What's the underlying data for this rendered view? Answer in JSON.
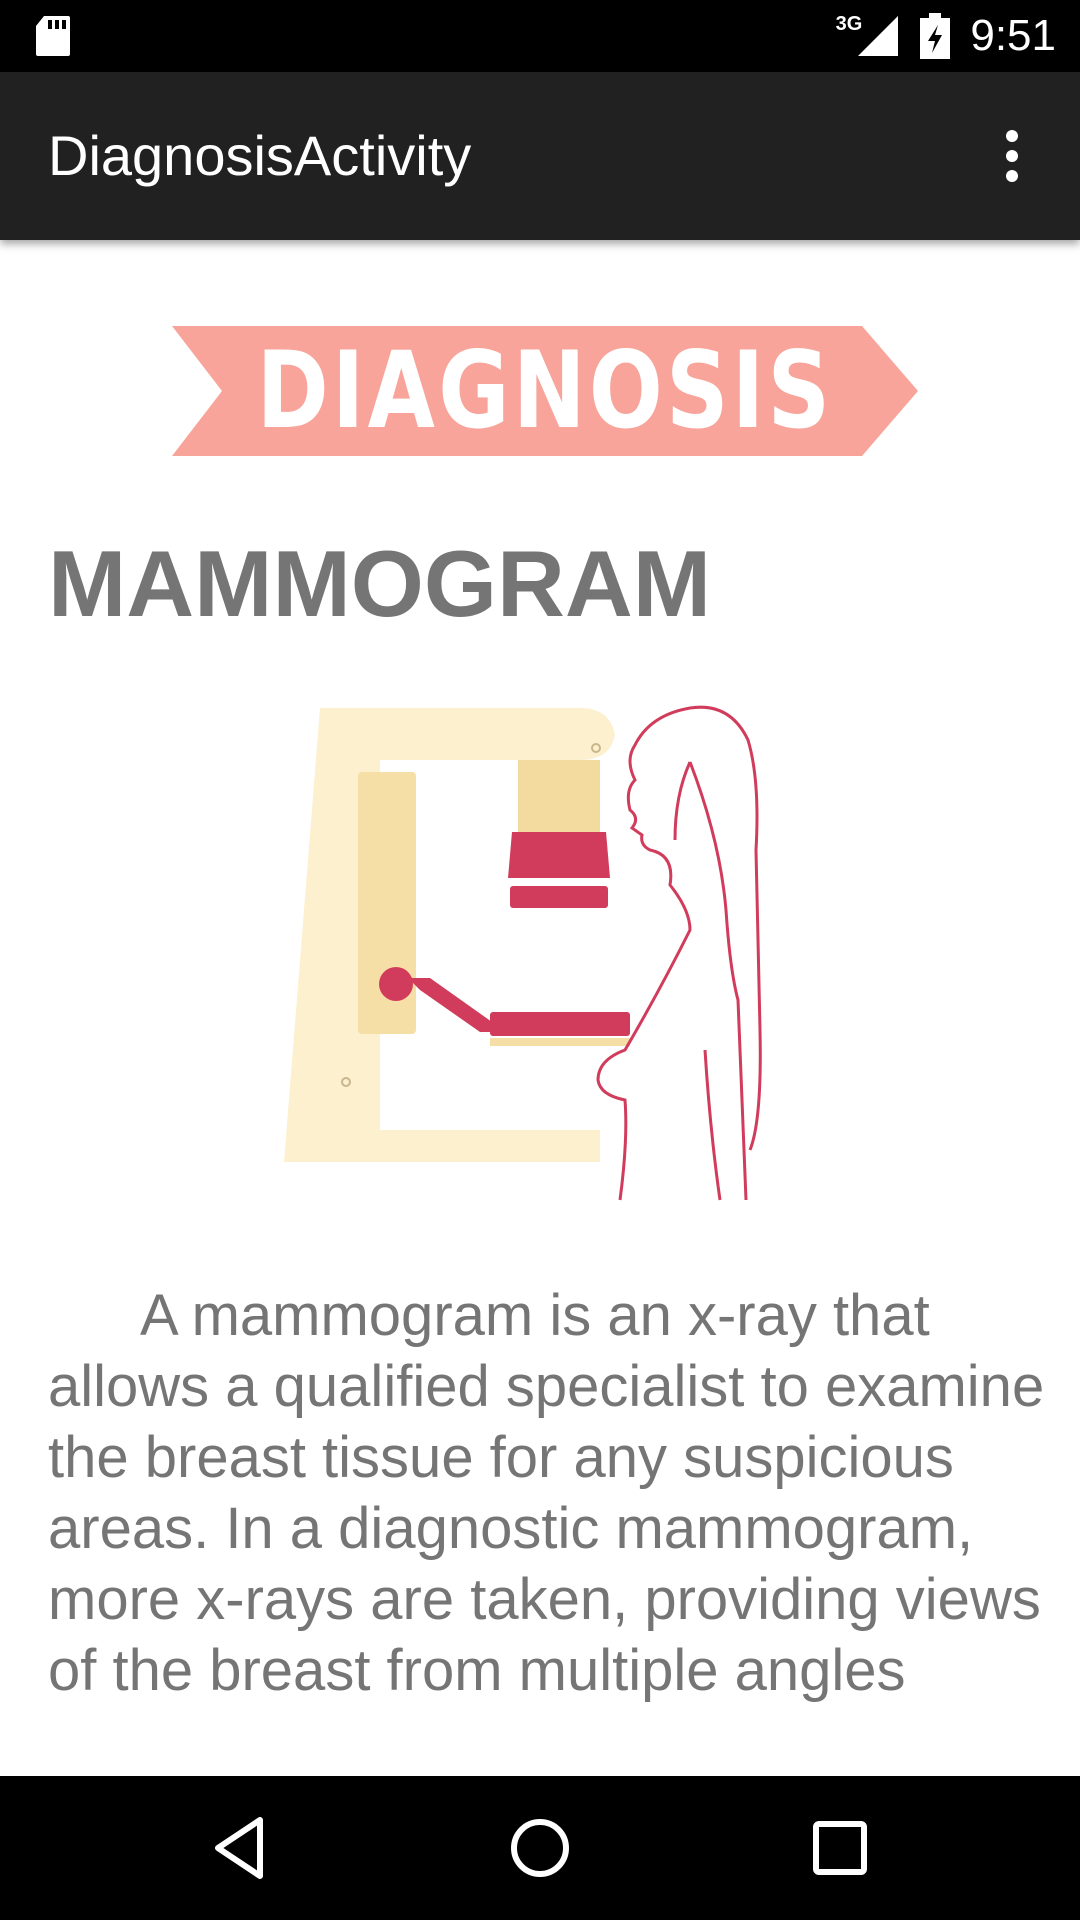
{
  "status_bar": {
    "network_label": "3G",
    "time": "9:51",
    "icons": [
      "sd-card-icon",
      "signal-icon",
      "battery-icon"
    ]
  },
  "app_bar": {
    "title": "DiagnosisActivity",
    "overflow_icon": "overflow-menu-icon"
  },
  "content": {
    "banner_text": "DIAGNOSIS",
    "heading": "MAMMOGRAM",
    "illustration": "mammogram-machine-illustration",
    "description": "A mammogram is an x-ray that allows a qualified specialist to examine the breast tissue for any suspicious areas.  In a diagnostic mammogram, more x-rays are taken, providing views of the breast from multiple angles"
  },
  "nav_bar": {
    "icons": [
      "back-icon",
      "home-icon",
      "recents-icon"
    ]
  },
  "colors": {
    "app_bar": "#212121",
    "banner": "#f8a49a",
    "accent": "#d13c5c",
    "machine": "#fdf0cf",
    "text": "#757575"
  }
}
